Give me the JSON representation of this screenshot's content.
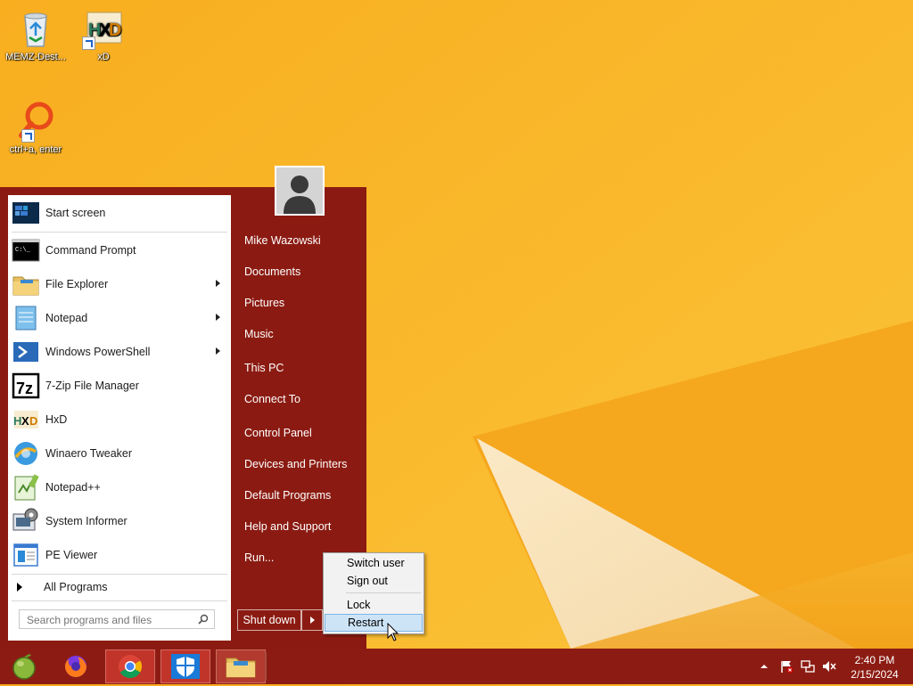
{
  "desktop": {
    "icons": [
      {
        "label": "MEMZ-Dest...",
        "icon": "recycle-bin-icon"
      },
      {
        "label": "xD",
        "icon": "hxd-icon"
      },
      {
        "label": "ctrl+a, enter",
        "icon": "magnifier-icon"
      }
    ]
  },
  "start_menu": {
    "programs": [
      {
        "label": "Start screen",
        "icon": "start-screen-icon",
        "submenu": false
      },
      {
        "label": "Command Prompt",
        "icon": "command-prompt-icon",
        "submenu": false
      },
      {
        "label": "File Explorer",
        "icon": "folder-icon",
        "submenu": true
      },
      {
        "label": "Notepad",
        "icon": "notepad-icon",
        "submenu": true
      },
      {
        "label": "Windows PowerShell",
        "icon": "powershell-icon",
        "submenu": true
      },
      {
        "label": "7-Zip File Manager",
        "icon": "7zip-icon",
        "submenu": false
      },
      {
        "label": "HxD",
        "icon": "hxd-icon",
        "submenu": false
      },
      {
        "label": "Winaero Tweaker",
        "icon": "winaero-icon",
        "submenu": false
      },
      {
        "label": "Notepad++",
        "icon": "notepadpp-icon",
        "submenu": false
      },
      {
        "label": "System Informer",
        "icon": "system-informer-icon",
        "submenu": false
      },
      {
        "label": "PE Viewer",
        "icon": "pe-viewer-icon",
        "submenu": false
      }
    ],
    "all_programs": "All Programs",
    "search_placeholder": "Search programs and files",
    "right_items": [
      "Mike Wazowski",
      "Documents",
      "Pictures",
      "Music",
      "This PC",
      "Connect To",
      "Control Panel",
      "Devices and Printers",
      "Default Programs",
      "Help and Support",
      "Run..."
    ],
    "shutdown_label": "Shut down"
  },
  "power_menu": {
    "items": [
      "Switch user",
      "Sign out",
      "Lock",
      "Restart"
    ],
    "highlighted": "Restart"
  },
  "taskbar": {
    "pinned": [
      "start-orb-icon",
      "firefox-icon",
      "chrome-icon",
      "defender-icon",
      "file-explorer-icon"
    ],
    "clock_time": "2:40 PM",
    "clock_date": "2/15/2024"
  },
  "colors": {
    "start_menu_bg": "#8b1b12",
    "taskbar_bg": "#8c1c13",
    "desktop_bg": "#f9b526",
    "highlight": "#cde4f7"
  }
}
